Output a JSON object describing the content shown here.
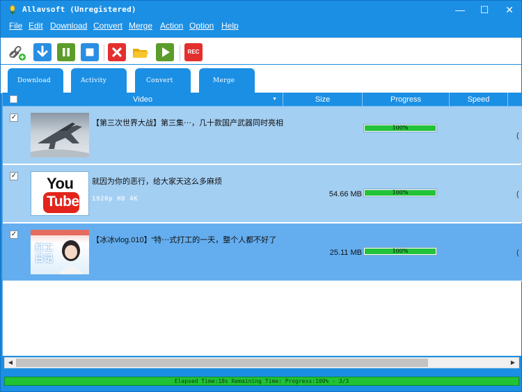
{
  "window": {
    "title": "Allavsoft (Unregistered)",
    "controls": {
      "minimize": "—",
      "maximize": "☐",
      "close": "✕"
    }
  },
  "menu": [
    {
      "label": "File"
    },
    {
      "label": "Edit"
    },
    {
      "label": "Download"
    },
    {
      "label": "Convert"
    },
    {
      "label": "Merge"
    },
    {
      "label": "Action"
    },
    {
      "label": "Option"
    },
    {
      "label": "Help"
    }
  ],
  "toolbar": {
    "buttons": [
      {
        "name": "add-url-icon"
      },
      {
        "name": "download-icon"
      },
      {
        "name": "pause-icon"
      },
      {
        "name": "stop-icon"
      },
      {
        "name": "delete-icon"
      },
      {
        "name": "open-folder-icon"
      },
      {
        "name": "play-icon"
      },
      {
        "name": "record-icon",
        "label": "REC"
      }
    ]
  },
  "tabs": [
    {
      "label": "Download"
    },
    {
      "label": "Activity"
    },
    {
      "label": "Convert"
    },
    {
      "label": "Merge"
    }
  ],
  "table": {
    "columns": [
      "Video",
      "Size",
      "Progress",
      "Speed"
    ],
    "rows": [
      {
        "checked": "✓",
        "title": "【第三次世界大战】第三集⋯，几十款国产武器同时亮相",
        "subtitle": "",
        "size": "",
        "progress": 100,
        "progress_label": "100%",
        "thumbnail": "jet-aircraft"
      },
      {
        "checked": "✓",
        "title": "就因为你的恶行，给大家天这么多麻烦",
        "subtitle": "1920p HD 4K",
        "size": "54.66 MB",
        "progress": 100,
        "progress_label": "100%",
        "thumbnail": "youtube-logo",
        "thumb_text_top": "You",
        "thumb_text_bottom": "Tube"
      },
      {
        "checked": "✓",
        "title": "【冰冰vlog.010】“特⋯式打工的一天，整个人都不好了",
        "subtitle": "",
        "size": "25.11 MB",
        "progress": 100,
        "progress_label": "100%",
        "thumbnail": "vlog-person",
        "thumb_text": "打工日记"
      }
    ]
  },
  "status": {
    "text": "Elapsed Time:18s Remaining Time: Progress:100% - 3/3"
  },
  "colors": {
    "window_blue": "#1b8fe4",
    "row_light": "#a3cff3",
    "row_selected": "#64aef0",
    "progress_green": "#22c239"
  }
}
